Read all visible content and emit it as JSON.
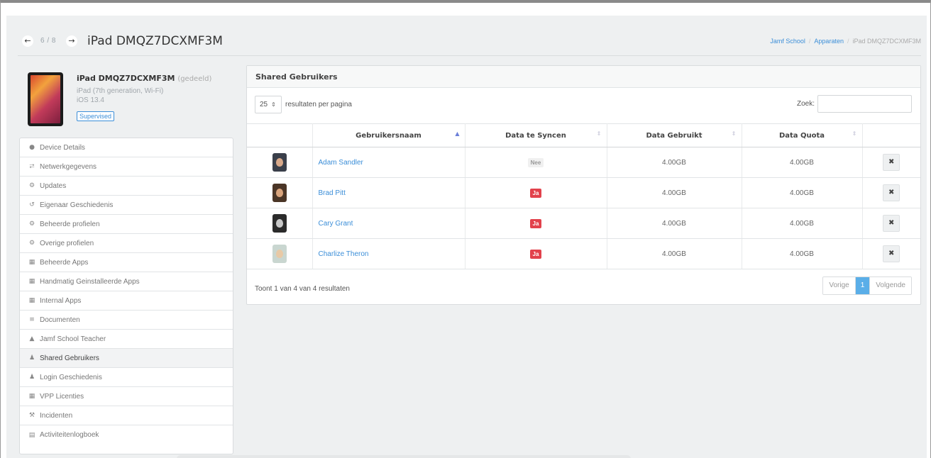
{
  "header": {
    "nav_count": "6 / 8",
    "prev_icon": "arrow-left-icon",
    "next_icon": "arrow-right-icon",
    "title": "iPad DMQZ7DCXMF3M",
    "breadcrumb": {
      "item1": "Jamf School",
      "item2": "Apparaten",
      "current": "iPad DMQZ7DCXMF3M",
      "separator": "/"
    }
  },
  "device": {
    "name": "iPad DMQZ7DCXMF3M",
    "shared_label": "(gedeeld)",
    "model": "iPad (7th generation, Wi-Fi)",
    "os": "iOS 13.4",
    "badge": "Supervised"
  },
  "sidebar": {
    "items": [
      {
        "label": "Device Details",
        "icon": "apple-icon"
      },
      {
        "label": "Netwerkgegevens",
        "icon": "network-icon"
      },
      {
        "label": "Updates",
        "icon": "gears-icon"
      },
      {
        "label": "Eigenaar Geschiedenis",
        "icon": "history-icon"
      },
      {
        "label": "Beheerde profielen",
        "icon": "gears-icon"
      },
      {
        "label": "Overige profielen",
        "icon": "gears-icon"
      },
      {
        "label": "Beheerde Apps",
        "icon": "apps-icon"
      },
      {
        "label": "Handmatig Geinstalleerde Apps",
        "icon": "apps-icon"
      },
      {
        "label": "Internal Apps",
        "icon": "apps-icon"
      },
      {
        "label": "Documenten",
        "icon": "books-icon"
      },
      {
        "label": "Jamf School Teacher",
        "icon": "graduation-cap-icon"
      },
      {
        "label": "Shared Gebruikers",
        "icon": "users-icon"
      },
      {
        "label": "Login Geschiedenis",
        "icon": "users-icon"
      },
      {
        "label": "VPP Licenties",
        "icon": "apps-icon"
      },
      {
        "label": "Incidenten",
        "icon": "gavel-icon"
      },
      {
        "label": "Activiteitenlogboek",
        "icon": "file-icon"
      }
    ],
    "active_index": 11
  },
  "panel": {
    "title": "Shared Gebruikers",
    "length_value": "25",
    "length_label": "resultaten per pagina",
    "search_label": "Zoek:",
    "search_value": "",
    "columns": [
      "",
      "Gebruikersnaam",
      "Data te Syncen",
      "Data Gebruikt",
      "Data Quota",
      ""
    ],
    "rows": [
      {
        "name": "Adam Sandler",
        "sync": "Nee",
        "used": "4.00GB",
        "quota": "4.00GB",
        "avatar_bg": "#3a3f4a",
        "face": "#d8a98a"
      },
      {
        "name": "Brad Pitt",
        "sync": "Ja",
        "used": "4.00GB",
        "quota": "4.00GB",
        "avatar_bg": "#4a3526",
        "face": "#d9a47c"
      },
      {
        "name": "Cary Grant",
        "sync": "Ja",
        "used": "4.00GB",
        "quota": "4.00GB",
        "avatar_bg": "#2b2b2b",
        "face": "#c9c9c9"
      },
      {
        "name": "Charlize Theron",
        "sync": "Ja",
        "used": "4.00GB",
        "quota": "4.00GB",
        "avatar_bg": "#c9d6d0",
        "face": "#e8c9a6"
      }
    ],
    "delete_icon": "close-icon",
    "info": "Toont 1 van 4 van 4 resultaten",
    "pager": {
      "prev": "Vorige",
      "current": "1",
      "next": "Volgende"
    }
  },
  "colors": {
    "link": "#3b8ed8",
    "badge_red": "#e2424c",
    "pager_active": "#5aaee8",
    "background": "#eef0f1"
  }
}
